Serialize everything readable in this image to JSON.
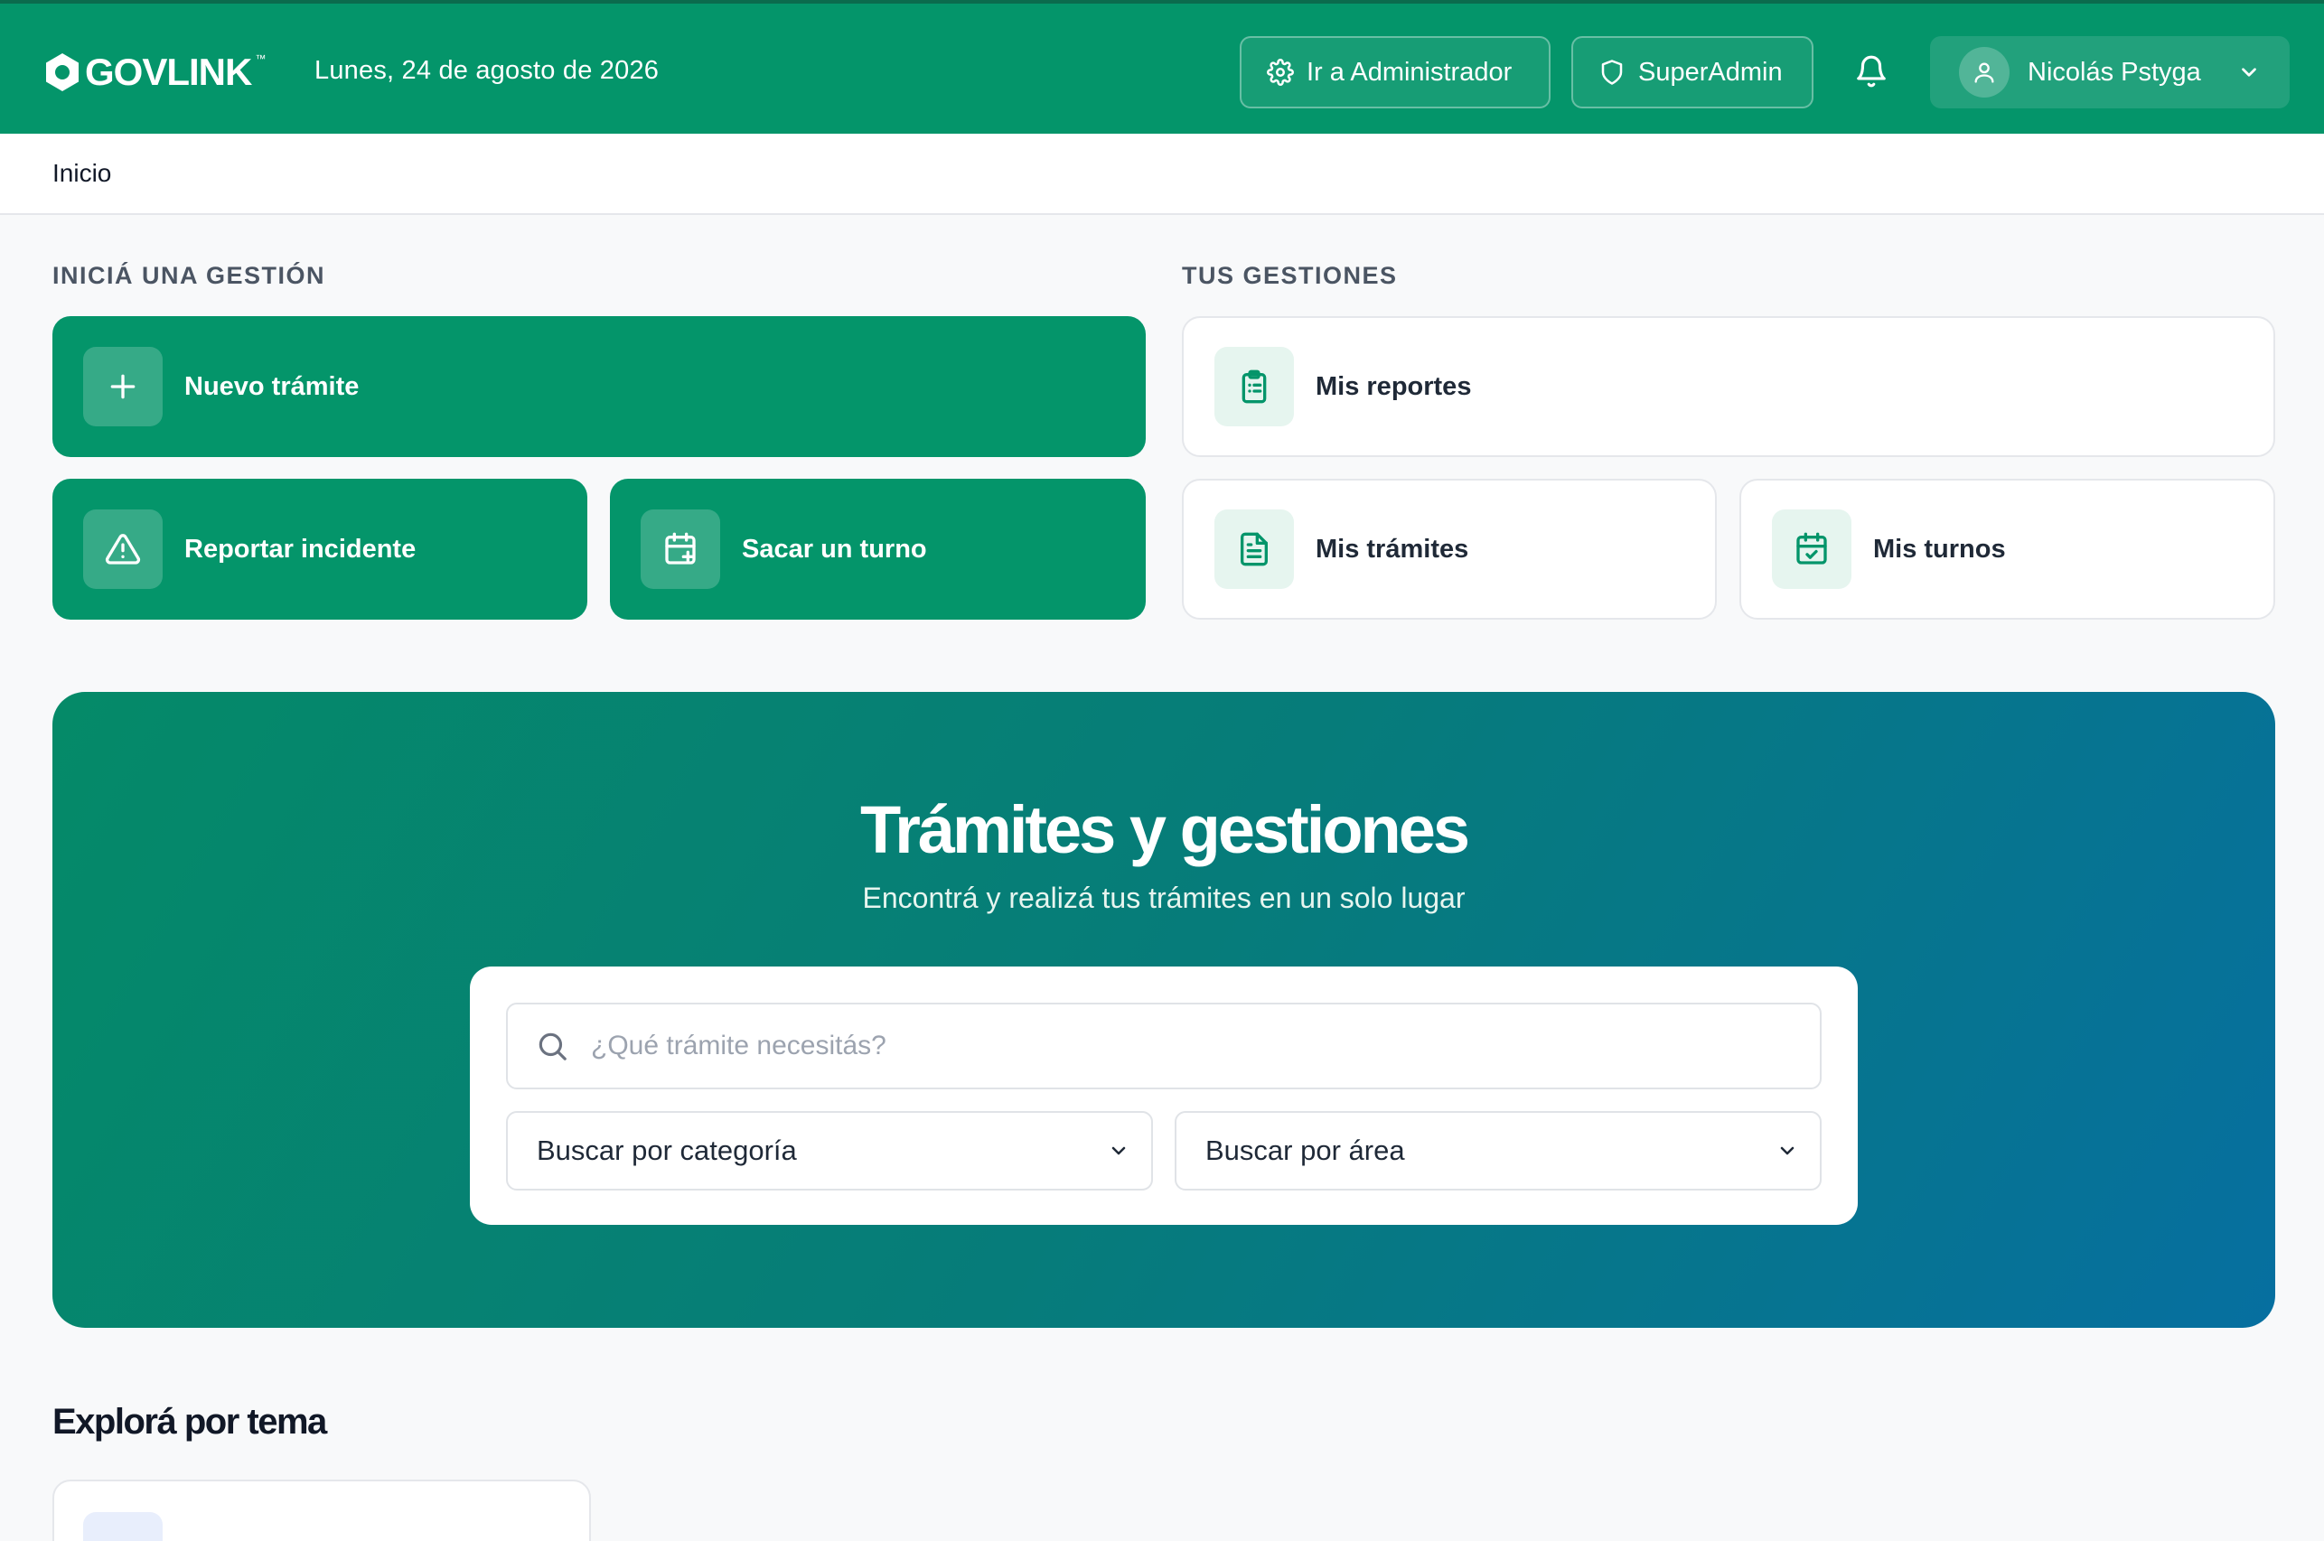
{
  "header": {
    "logo_text": "GOVLINK",
    "logo_tm": "™",
    "date": "Lunes, 24 de agosto de 2026",
    "admin_button": "Ir a Administrador",
    "superadmin_button": "SuperAdmin",
    "user_name": "Nicolás Pstyga"
  },
  "breadcrumb": "Inicio",
  "start": {
    "title": "INICIÁ UNA GESTIÓN",
    "new_procedure": "Nuevo trámite",
    "report_incident": "Reportar incidente",
    "book_appointment": "Sacar un turno"
  },
  "mine": {
    "title": "TUS GESTIONES",
    "reports": "Mis reportes",
    "procedures": "Mis trámites",
    "appointments": "Mis turnos"
  },
  "hero": {
    "title": "Trámites y gestiones",
    "subtitle": "Encontrá y realizá tus trámites en un solo lugar",
    "search_placeholder": "¿Qué trámite necesitás?",
    "category_select": "Buscar por categoría",
    "area_select": "Buscar por área"
  },
  "explore": {
    "title": "Explorá por tema"
  },
  "colors": {
    "brand": "#04956a",
    "hero_gradient_start": "#058a68",
    "hero_gradient_end": "#066fa0"
  }
}
